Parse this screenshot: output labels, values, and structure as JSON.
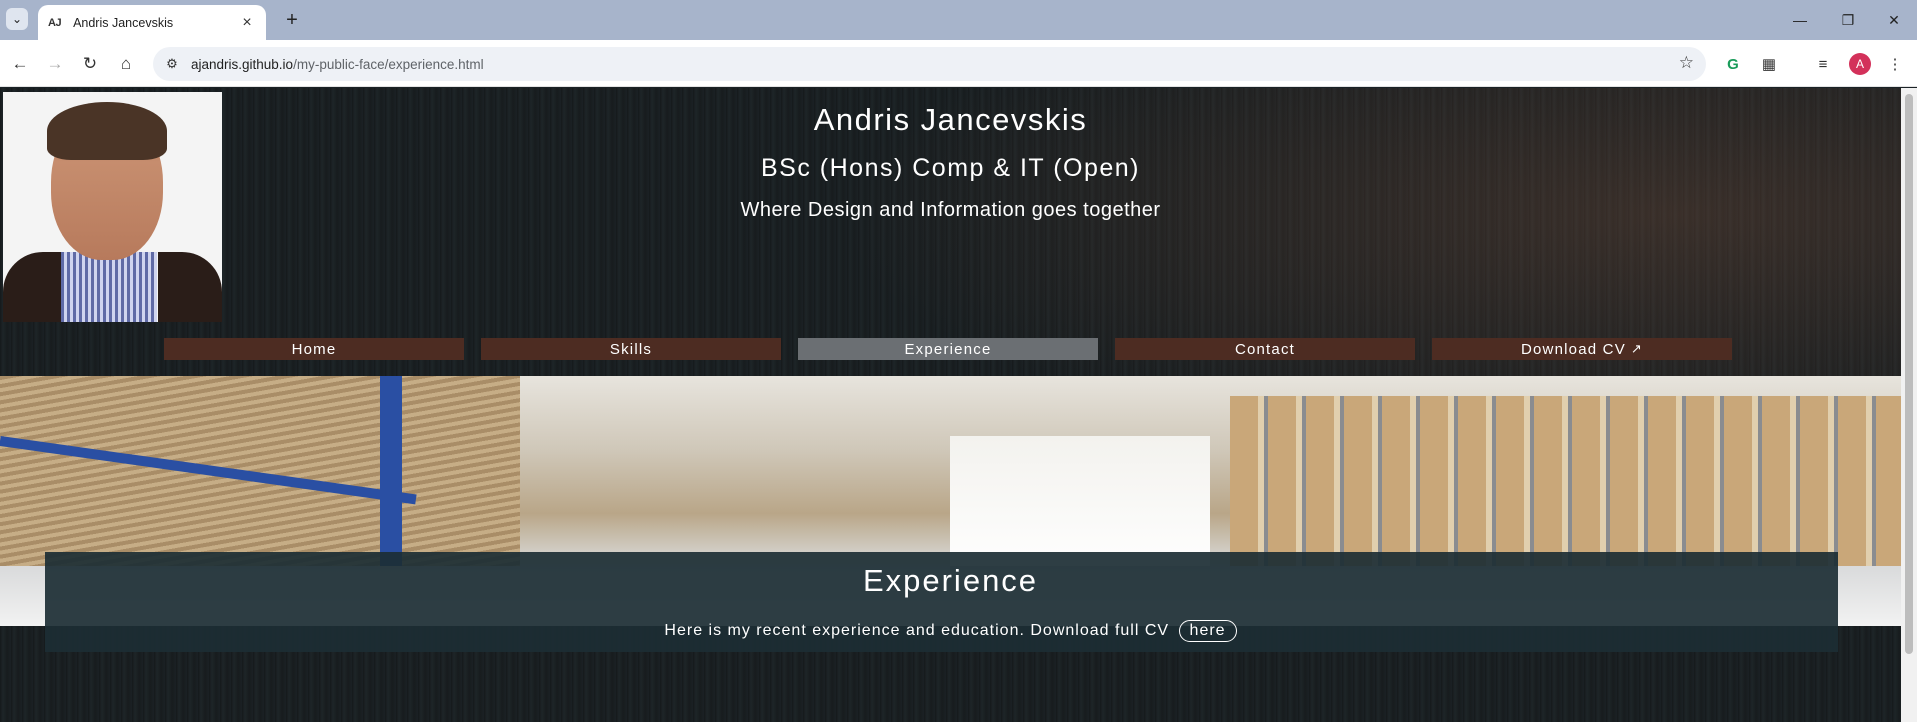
{
  "browser": {
    "tab_title": "Andris Jancevskis",
    "tab_favicon": "AJ",
    "url_host": "ajandris.github.io",
    "url_path": "/my-public-face/experience.html",
    "profile_initial": "A",
    "icons": [
      "tab-list-icon",
      "close-icon",
      "new-tab-icon",
      "minimize-icon",
      "restore-icon",
      "window-close-icon",
      "back-icon",
      "forward-icon",
      "reload-icon",
      "home-icon",
      "site-info-icon",
      "bookmark-star-icon",
      "grammarly-icon",
      "extensions-icon",
      "media-icon",
      "menu-icon"
    ]
  },
  "header": {
    "name": "Andris Jancevskis",
    "degree": "BSc (Hons) Comp & IT (Open)",
    "tagline": "Where Design and Information goes together"
  },
  "nav": {
    "items": [
      {
        "label": "Home"
      },
      {
        "label": "Skills"
      },
      {
        "label": "Experience",
        "active": true
      },
      {
        "label": "Contact"
      },
      {
        "label": "Download CV"
      }
    ]
  },
  "main": {
    "title": "Experience",
    "intro": "Here is my recent experience and education. Download full CV",
    "link_label": "here"
  },
  "colors": {
    "nav_bg": "#4d2c22",
    "nav_active": "#6b6f73",
    "content_bg": "#1c2e34"
  }
}
